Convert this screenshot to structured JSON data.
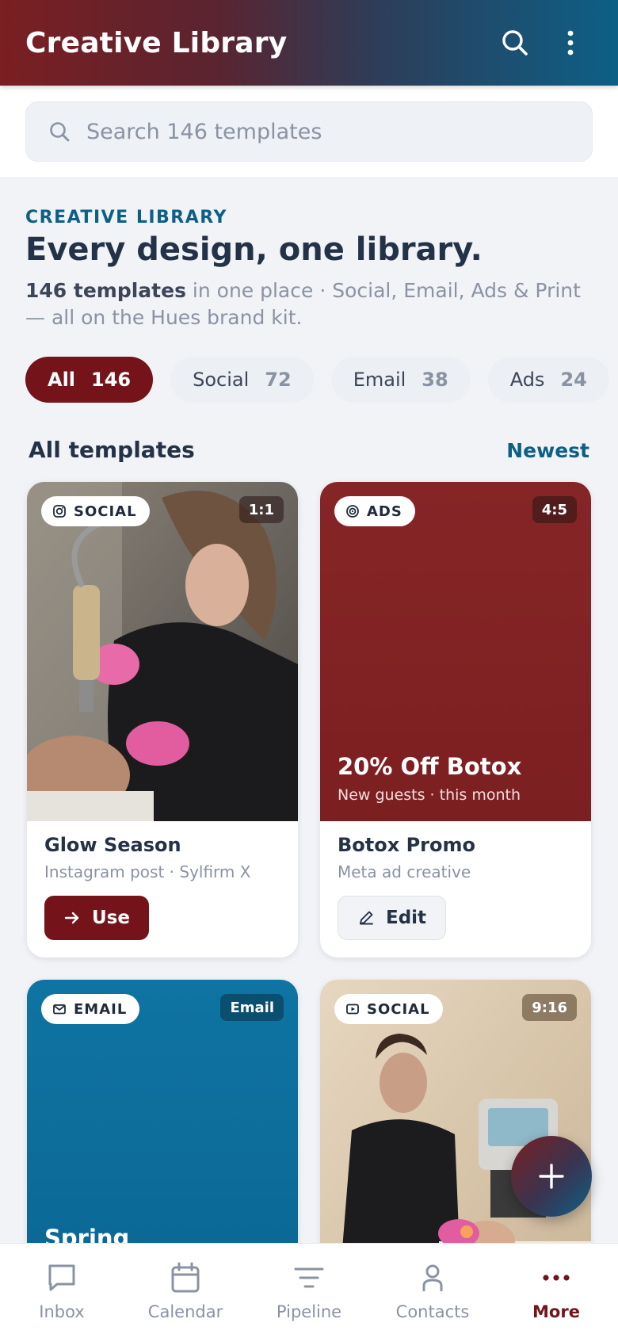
{
  "appbar": {
    "title": "Creative Library",
    "search_icon": "search-icon",
    "menu_icon": "kebab-menu-icon"
  },
  "search": {
    "placeholder": "Search 146 templates",
    "value": ""
  },
  "hero": {
    "eyebrow": "CREATIVE LIBRARY",
    "title": "Every design, one library.",
    "subtitle_bold": "146 templates",
    "subtitle_rest": " in one place · Social, Email, Ads & Print — all on the Hues brand kit."
  },
  "filters": [
    {
      "label": "All",
      "count": "146",
      "active": true
    },
    {
      "label": "Social",
      "count": "72",
      "active": false
    },
    {
      "label": "Email",
      "count": "38",
      "active": false
    },
    {
      "label": "Ads",
      "count": "24",
      "active": false
    }
  ],
  "section": {
    "title": "All templates",
    "sort": "Newest"
  },
  "cards": [
    {
      "type": "SOCIAL",
      "type_icon": "instagram-icon",
      "ratio": "1:1",
      "title": "Glow Season",
      "meta": "Instagram post · Sylfirm X",
      "action": "Use",
      "action_icon": "arrow-right-icon"
    },
    {
      "type": "ADS",
      "type_icon": "target-icon",
      "ratio": "4:5",
      "promo_headline": "20% Off Botox",
      "promo_sub": "New guests · this month",
      "title": "Botox Promo",
      "meta": "Meta ad creative",
      "action": "Edit",
      "action_icon": "pencil-icon"
    },
    {
      "type": "EMAIL",
      "type_icon": "mail-icon",
      "ratio": "Email",
      "promo_headline": "Spring"
    },
    {
      "type": "SOCIAL",
      "type_icon": "video-icon",
      "ratio": "9:16"
    }
  ],
  "fab": {
    "icon": "plus-icon"
  },
  "bottom_nav": [
    {
      "label": "Inbox",
      "icon": "chat-bubble-icon",
      "active": false
    },
    {
      "label": "Calendar",
      "icon": "calendar-icon",
      "active": false
    },
    {
      "label": "Pipeline",
      "icon": "filter-lines-icon",
      "active": false
    },
    {
      "label": "Contacts",
      "icon": "person-icon",
      "active": false
    },
    {
      "label": "More",
      "icon": "more-dots-icon",
      "active": true
    }
  ],
  "colors": {
    "brand_red": "#74141a",
    "brand_blue": "#0d5f86",
    "ad_red": "#8a2424",
    "email_blue": "#0d6e9c"
  }
}
